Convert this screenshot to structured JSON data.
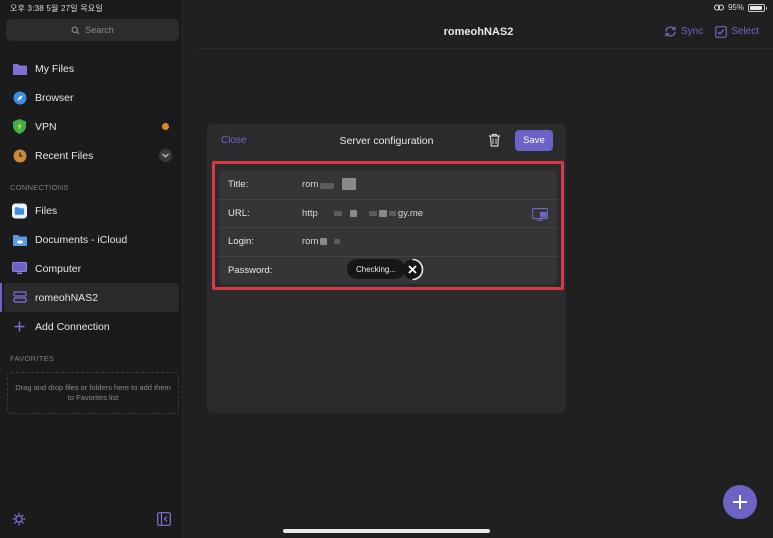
{
  "status": {
    "time_date": "오후 3:38  5월 27일 목요일",
    "battery": "95%",
    "battery_level": 0.95
  },
  "sidebar": {
    "search_placeholder": "Search",
    "items": [
      {
        "label": "My Files",
        "icon": "folder-icon"
      },
      {
        "label": "Browser",
        "icon": "compass-icon"
      },
      {
        "label": "VPN",
        "icon": "shield-icon"
      },
      {
        "label": "Recent Files",
        "icon": "clock-icon"
      }
    ],
    "connections_header": "CONNECTIONS",
    "connections": [
      {
        "label": "Files",
        "icon": "files-app-icon"
      },
      {
        "label": "Documents - iCloud",
        "icon": "icloud-folder-icon"
      },
      {
        "label": "Computer",
        "icon": "monitor-icon"
      },
      {
        "label": "romeohNAS2",
        "icon": "nas-icon",
        "active": true
      },
      {
        "label": "Add Connection",
        "icon": "plus-icon"
      }
    ],
    "favorites_header": "FAVORITES",
    "favorites_hint": "Drag and drop files or folders here to add them to Favorites list"
  },
  "main": {
    "title": "romeohNAS2",
    "sync_label": "Sync",
    "select_label": "Select"
  },
  "modal": {
    "close_label": "Close",
    "title": "Server configuration",
    "save_label": "Save",
    "fields": {
      "title_label": "Title:",
      "title_value": "rom",
      "url_label": "URL:",
      "url_prefix": "http",
      "url_suffix": "gy.me",
      "login_label": "Login:",
      "login_value": "rom",
      "password_label": "Password:"
    },
    "checking_text": "Checking..."
  },
  "colors": {
    "accent": "#6b63c5",
    "highlight": "#d53a45",
    "vpn_dot": "#d98a2b"
  }
}
